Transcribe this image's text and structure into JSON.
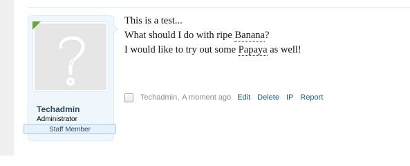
{
  "user": {
    "name": "Techadmin",
    "title": "Administrator",
    "banner": "Staff Member"
  },
  "message": {
    "lines": [
      {
        "text": "This is a test..."
      },
      {
        "prefix": "What should I do with ripe ",
        "keyword": "Banana",
        "suffix": "?"
      },
      {
        "prefix": "I would like to try out some ",
        "keyword": "Papaya",
        "suffix": " as well!"
      }
    ]
  },
  "meta": {
    "author": "Techadmin",
    "separator": ",",
    "time": "A moment ago",
    "actions": {
      "edit": "Edit",
      "delete": "Delete",
      "ip": "IP",
      "report": "Report"
    }
  },
  "colors": {
    "online_indicator": "#6ca42c",
    "username": "#2b485c",
    "link": "#176093",
    "muted": "#8f8f8f",
    "card_background": "#f0f7fc"
  },
  "icons": {
    "avatar": "question-mark-avatar-placeholder"
  }
}
